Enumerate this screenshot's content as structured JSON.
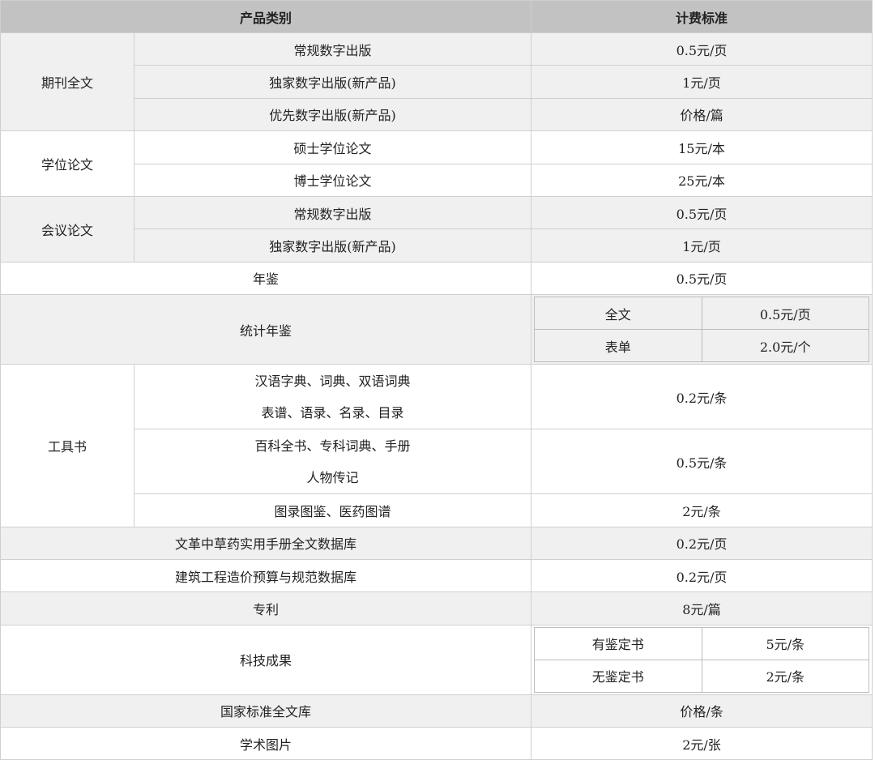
{
  "header": {
    "category": "产品类别",
    "pricing": "计费标准"
  },
  "journal": {
    "label": "期刊全文",
    "rows": [
      {
        "name": "常规数字出版",
        "price": "0.5元/页"
      },
      {
        "name": "独家数字出版(新产品)",
        "price": "1元/页"
      },
      {
        "name": "优先数字出版(新产品)",
        "price": "价格/篇"
      }
    ]
  },
  "thesis": {
    "label": "学位论文",
    "rows": [
      {
        "name": "硕士学位论文",
        "price": "15元/本"
      },
      {
        "name": "博士学位论文",
        "price": "25元/本"
      }
    ]
  },
  "conference": {
    "label": "会议论文",
    "rows": [
      {
        "name": "常规数字出版",
        "price": "0.5元/页"
      },
      {
        "name": "独家数字出版(新产品)",
        "price": "1元/页"
      }
    ]
  },
  "yearbook": {
    "label": "年鉴",
    "price": "0.5元/页"
  },
  "stat_yearbook": {
    "label": "统计年鉴",
    "sub": [
      {
        "name": "全文",
        "price": "0.5元/页"
      },
      {
        "name": "表单",
        "price": "2.0元/个"
      }
    ]
  },
  "reference_books": {
    "label": "工具书",
    "rows": [
      {
        "line1": "汉语字典、词典、双语词典",
        "line2": "表谱、语录、名录、目录",
        "price": "0.2元/条"
      },
      {
        "line1": "百科全书、专科词典、手册",
        "line2": "人物传记",
        "price": "0.5元/条"
      },
      {
        "line1": "图录图鉴、医药图谱",
        "price": "2元/条"
      }
    ]
  },
  "herbal_db": {
    "label": "文革中草药实用手册全文数据库",
    "price": "0.2元/页"
  },
  "construction_db": {
    "label": "建筑工程造价预算与规范数据库",
    "price": "0.2元/页"
  },
  "patent": {
    "label": "专利",
    "price": "8元/篇"
  },
  "tech_results": {
    "label": "科技成果",
    "sub": [
      {
        "name": "有鉴定书",
        "price": "5元/条"
      },
      {
        "name": "无鉴定书",
        "price": "2元/条"
      }
    ]
  },
  "national_standards": {
    "label": "国家标准全文库",
    "price": "价格/条"
  },
  "academic_images": {
    "label": "学术图片",
    "price": "2元/张"
  }
}
